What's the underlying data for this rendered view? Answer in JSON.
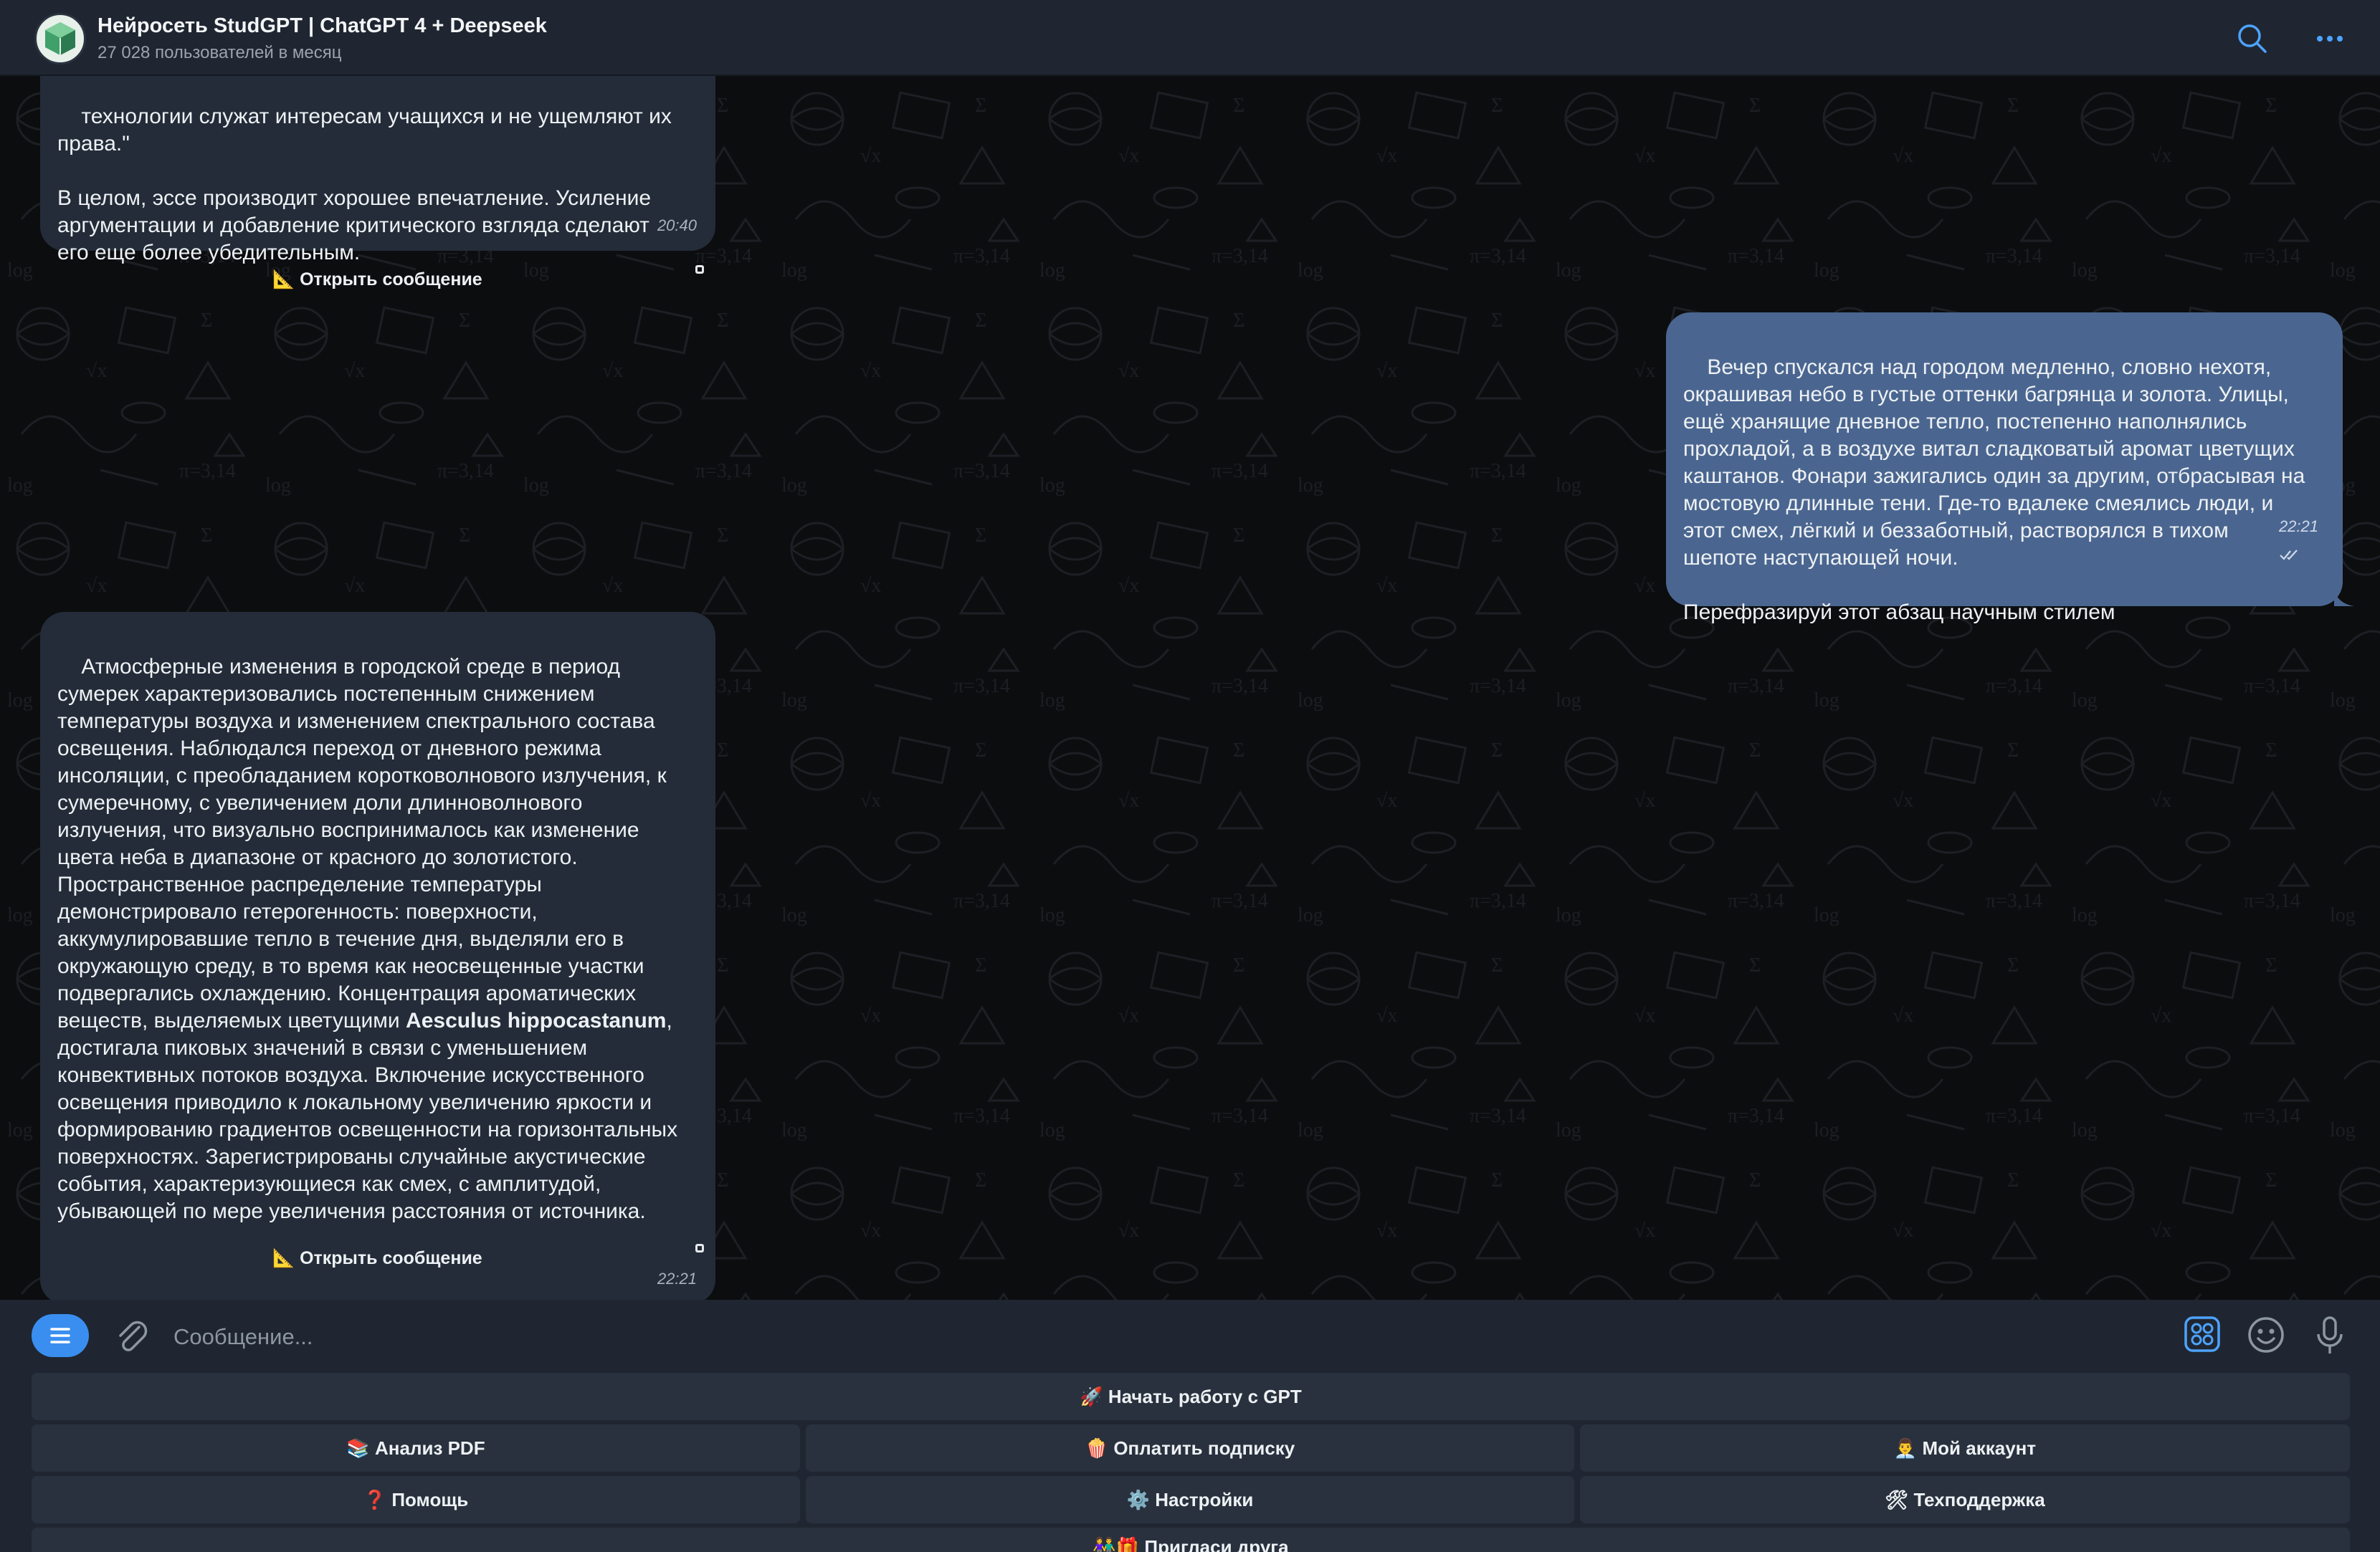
{
  "header": {
    "title": "Нейросеть StudGPT | ChatGPT 4 + Deepseek",
    "subtitle": "27 028 пользователей в месяц"
  },
  "messages": [
    {
      "id": "msg1",
      "direction": "incoming",
      "text": "технологии служат интересам учащихся и не ущемляют их\nправа.\"\n\nВ целом, эссе производит хорошее впечатление. Усиление\nаргументации и добавление критического взгляда сделают\nего еще более убедительным.",
      "time": "20:40",
      "action": "📐 Открыть сообщение"
    },
    {
      "id": "msg2",
      "direction": "outgoing",
      "text": "Вечер спускался над городом медленно, словно нехотя,\nокрашивая небо в густые оттенки багрянца и золота. Улицы,\nещё хранящие дневное тепло, постепенно наполнялись\nпрохладой, а в воздухе витал сладковатый аромат цветущих\nкаштанов. Фонари зажигались один за другим, отбрасывая на\nмостовую длинные тени. Где-то вдалеке смеялись люди, и\nэтот смех, лёгкий и беззаботный, растворялся в тихом\nшепоте наступающей ночи.\n\nПерефразируй этот абзац научным стилем",
      "time": "22:21",
      "status": "read"
    },
    {
      "id": "msg3",
      "direction": "incoming",
      "text_before_bold": "Атмосферные изменения в городской среде в период\nсумерек характеризовались постепенным снижением\nтемпературы воздуха и изменением спектрального состава\nосвещения. Наблюдался переход от дневного режима\nинсоляции, с преобладанием коротковолнового излучения, к\nсумеречному, с увеличением доли длинноволнового\nизлучения, что визуально воспринималось как изменение\nцвета неба в диапазоне от красного до золотистого.\nПространственное распределение температуры\nдемонстрировало гетерогенность: поверхности,\nаккумулировавшие тепло в течение дня, выделяли его в\nокружающую среду, в то время как неосвещенные участки\nподвергались охлаждению. Концентрация ароматических\nвеществ, выделяемых цветущими ",
      "bold": "Aesculus hippocastanum",
      "text_after_bold": ",\nдостигала пиковых значений в связи с уменьшением\nконвективных потоков воздуха. Включение искусственного\nосвещения приводило к локальному увеличению яркости и\nформированию градиентов освещенности на горизонтальных\nповерхностях. Зарегистрированы случайные акустические\nсобытия, характеризующиеся как смех, с амплитудой,\nубывающей по мере увеличения расстояния от источника.",
      "time": "22:21",
      "action": "📐 Открыть сообщение"
    }
  ],
  "composer": {
    "placeholder": "Сообщение..."
  },
  "keyboard": {
    "row1": [
      "🚀 Начать работу с GPT"
    ],
    "row2": [
      "📚 Анализ PDF",
      "🍿 Оплатить подписку",
      "👨‍💼 Мой аккаунт"
    ],
    "row3": [
      "❓ Помощь",
      "⚙️ Настройки",
      "🛠 Техподдержка"
    ],
    "row4": [
      "👫🎁 Пригласи друга"
    ]
  },
  "colors": {
    "header_bg": "#1f2631",
    "incoming_bubble": "#232c38",
    "outgoing_bubble": "#4a6690",
    "accent": "#3a8ef0"
  },
  "icons": [
    "search-icon",
    "more-icon",
    "menu-icon",
    "paperclip-icon",
    "sticker-grid-icon",
    "emoji-icon",
    "microphone-icon",
    "double-check-icon"
  ]
}
